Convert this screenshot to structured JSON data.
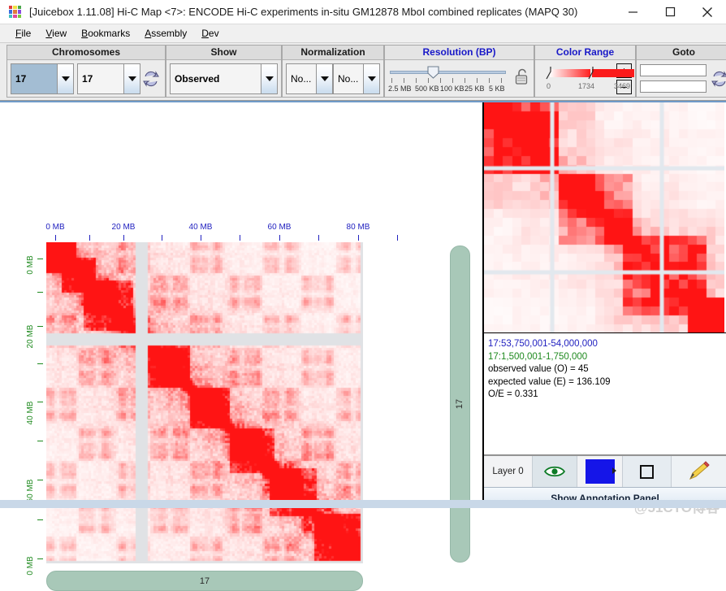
{
  "window": {
    "title": "[Juicebox 1.11.08] Hi-C Map <7>:  ENCODE Hi-C experiments in-situ GM12878 MboI combined replicates (MAPQ 30)",
    "app_icon": "juicebox-grid-icon",
    "minimize_label": "–",
    "maximize_label": "□",
    "close_label": "✕"
  },
  "menubar": {
    "items": [
      {
        "label": "File",
        "mnemonic": "F"
      },
      {
        "label": "View",
        "mnemonic": "V"
      },
      {
        "label": "Bookmarks",
        "mnemonic": "B"
      },
      {
        "label": "Assembly",
        "mnemonic": "A"
      },
      {
        "label": "Dev",
        "mnemonic": "D"
      }
    ]
  },
  "toolbar": {
    "chromosomes": {
      "title": "Chromosomes",
      "x_value": "17",
      "y_value": "17",
      "swap_icon": "refresh-swap-icon"
    },
    "show": {
      "title": "Show",
      "value": "Observed"
    },
    "normalization": {
      "title": "Normalization",
      "value_1": "No...",
      "value_2": "No..."
    },
    "resolution": {
      "title": "Resolution (BP)",
      "ticks": [
        "2.5 MB",
        "500 KB",
        "100 KB",
        "25 KB",
        "5 KB"
      ],
      "lock_icon": "unlocked-padlock-icon"
    },
    "color_range": {
      "title": "Color Range",
      "min": "0",
      "mid": "1734",
      "max": "3469",
      "plus_label": "+",
      "minus_label": "−"
    },
    "goto": {
      "title": "Goto",
      "field_1_value": "",
      "field_2_value": "",
      "field_1_placeholder": "",
      "field_2_placeholder": "",
      "refresh_icon": "refresh-swap-icon"
    }
  },
  "map_view": {
    "x_axis": {
      "label_color": "#2222c0",
      "ticks": [
        "0 MB",
        "20 MB",
        "40 MB",
        "60 MB",
        "80 MB"
      ]
    },
    "y_axis": {
      "label_color": "#1f8a1f",
      "ticks": [
        "0 MB",
        "20 MB",
        "40 MB",
        "60 MB",
        "0 MB"
      ]
    },
    "chromosome_bottom_label": "17",
    "chromosome_right_label": "17"
  },
  "info_panel": {
    "position_x": "17:53,750,001-54,000,000",
    "position_y": "17:1,500,001-1,750,000",
    "observed": "observed value (O) = 45",
    "expected": "expected value (E) = 136.109",
    "oe_ratio": "O/E = 0.331"
  },
  "layer_bar": {
    "layer_label": "Layer 0",
    "eye_icon": "eye-visibility-icon",
    "color_swatch": "#1515e8",
    "color_arrow_icon": "triangle-right-icon",
    "square_icon": "square-outline-icon",
    "pencil_icon": "pencil-edit-icon"
  },
  "annotation_bar": {
    "label": "Show Annotation Panel"
  },
  "watermark": "@51CTO博客",
  "colors": {
    "accent_blue": "#1818c8",
    "axis_green": "#1f8a1f",
    "heat_red": "#fb1b1b",
    "chrom_green": "#a8c8b8",
    "layer_blue": "#1515e8"
  }
}
